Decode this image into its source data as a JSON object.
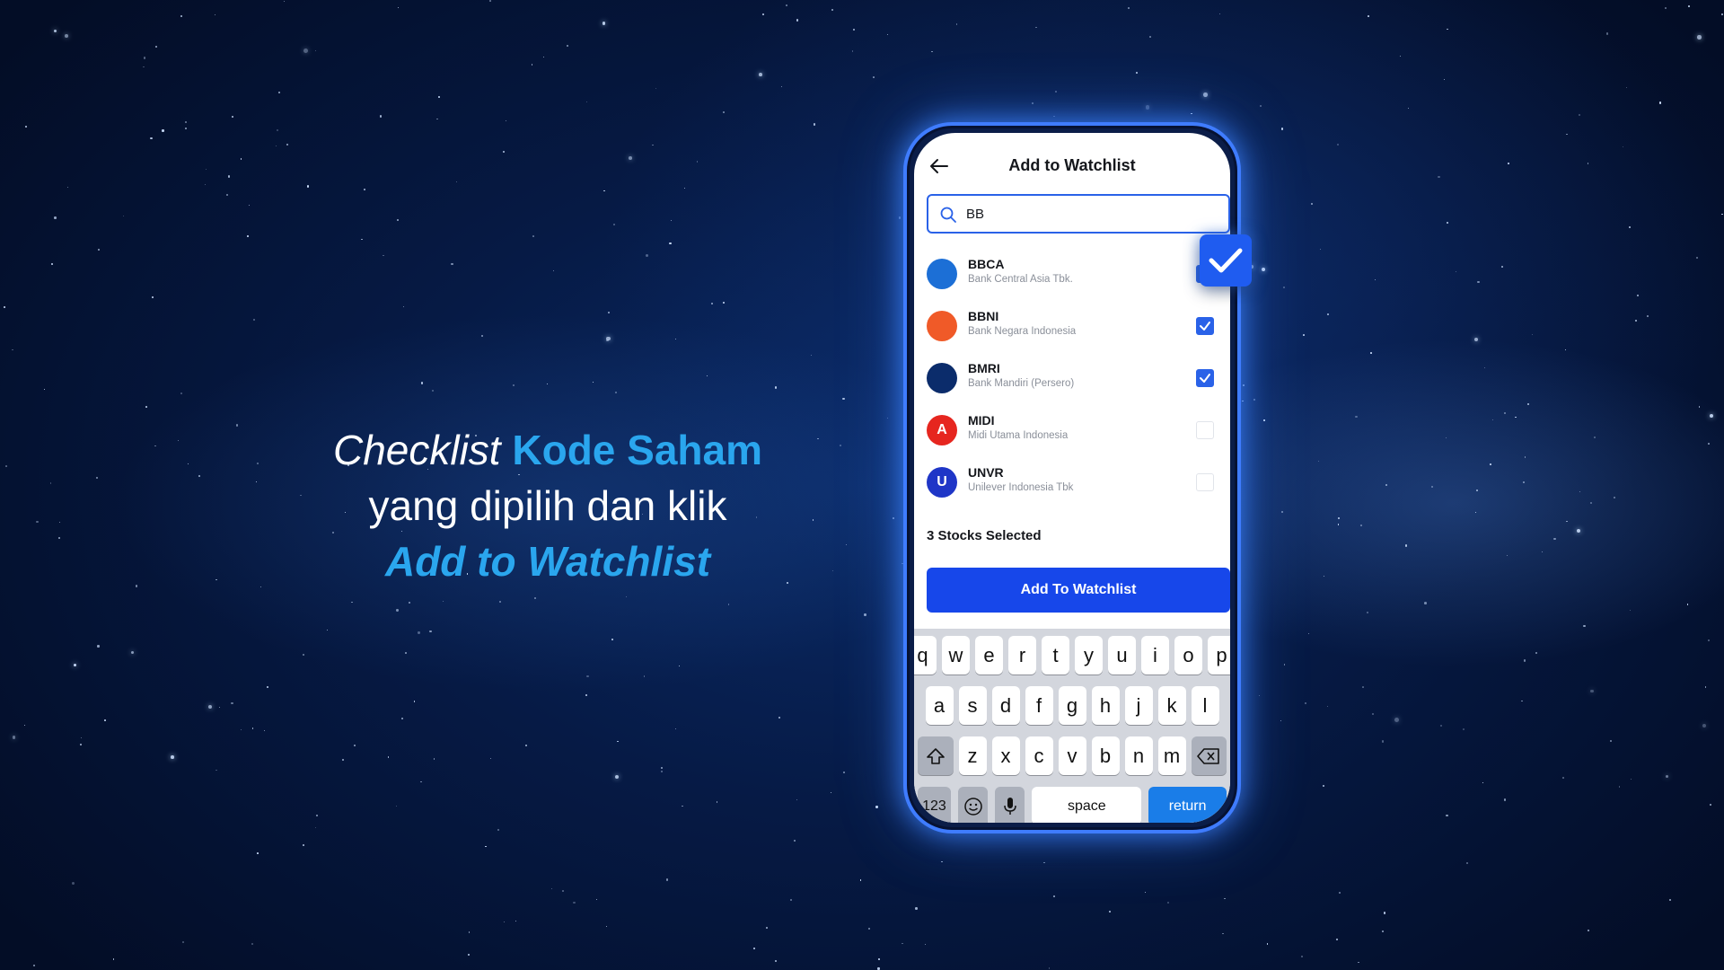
{
  "headline": {
    "line1_word1": "Checklist",
    "line1_word2": "Kode Saham",
    "line2": "yang dipilih dan klik",
    "line3": "Add to Watchlist"
  },
  "colors": {
    "accent_text": "#2aa6ee",
    "primary_button": "#1747ea",
    "checkbox_on": "#2a62e8",
    "phone_glow": "#3f7cff"
  },
  "app": {
    "title": "Add to Watchlist",
    "back_icon": "arrow-left-icon",
    "search": {
      "value": "BB",
      "icon": "search-icon"
    },
    "stocks": [
      {
        "code": "BBCA",
        "name": "Bank Central Asia Tbk.",
        "checked": true,
        "logo_color": "#1c6fd6",
        "logo_letter": ""
      },
      {
        "code": "BBNI",
        "name": "Bank Negara Indonesia",
        "checked": true,
        "logo_color": "#f05a28",
        "logo_letter": ""
      },
      {
        "code": "BMRI",
        "name": "Bank Mandiri (Persero)",
        "checked": true,
        "logo_color": "#0b2c6b",
        "logo_letter": ""
      },
      {
        "code": "MIDI",
        "name": "Midi Utama Indonesia",
        "checked": false,
        "logo_color": "#e6261f",
        "logo_letter": "A"
      },
      {
        "code": "UNVR",
        "name": "Unilever Indonesia Tbk",
        "checked": false,
        "logo_color": "#1f36c7",
        "logo_letter": "U"
      }
    ],
    "selected_count": "3 Stocks Selected",
    "add_button": "Add To Watchlist"
  },
  "keyboard": {
    "row1": [
      "q",
      "w",
      "e",
      "r",
      "t",
      "y",
      "u",
      "i",
      "o",
      "p"
    ],
    "row2": [
      "a",
      "s",
      "d",
      "f",
      "g",
      "h",
      "j",
      "k",
      "l"
    ],
    "row3": [
      "z",
      "x",
      "c",
      "v",
      "b",
      "n",
      "m"
    ],
    "numbers": "123",
    "space": "space",
    "return": "return"
  }
}
